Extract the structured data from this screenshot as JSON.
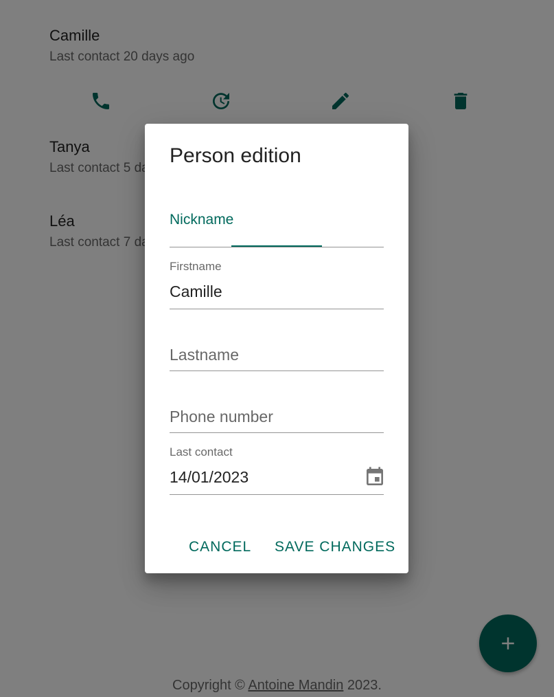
{
  "persons": [
    {
      "name": "Camille",
      "last_contact": "Last contact 20 days ago"
    },
    {
      "name": "Tanya",
      "last_contact": "Last contact 5 days ago"
    },
    {
      "name": "Léa",
      "last_contact": "Last contact 7 days ago"
    }
  ],
  "actions": {
    "call": "phone-icon",
    "update": "update-icon",
    "edit": "edit-icon",
    "delete": "delete-icon"
  },
  "footer": {
    "prefix": "Copyright © ",
    "author": "Antoine Mandin",
    "suffix": " 2023."
  },
  "fab": {
    "icon": "add-icon"
  },
  "dialog": {
    "title": "Person edition",
    "fields": {
      "nickname": {
        "label": "Nickname",
        "value": ""
      },
      "firstname": {
        "label": "Firstname",
        "value": "Camille"
      },
      "lastname": {
        "label": "Lastname",
        "value": ""
      },
      "phone": {
        "label": "Phone number",
        "value": ""
      },
      "last_contact": {
        "label": "Last contact",
        "value": "14/01/2023"
      }
    },
    "cancel_label": "CANCEL",
    "save_label": "SAVE CHANGES"
  },
  "colors": {
    "accent": "#00695c",
    "backdrop": "rgba(0,0,0,0.5)"
  }
}
